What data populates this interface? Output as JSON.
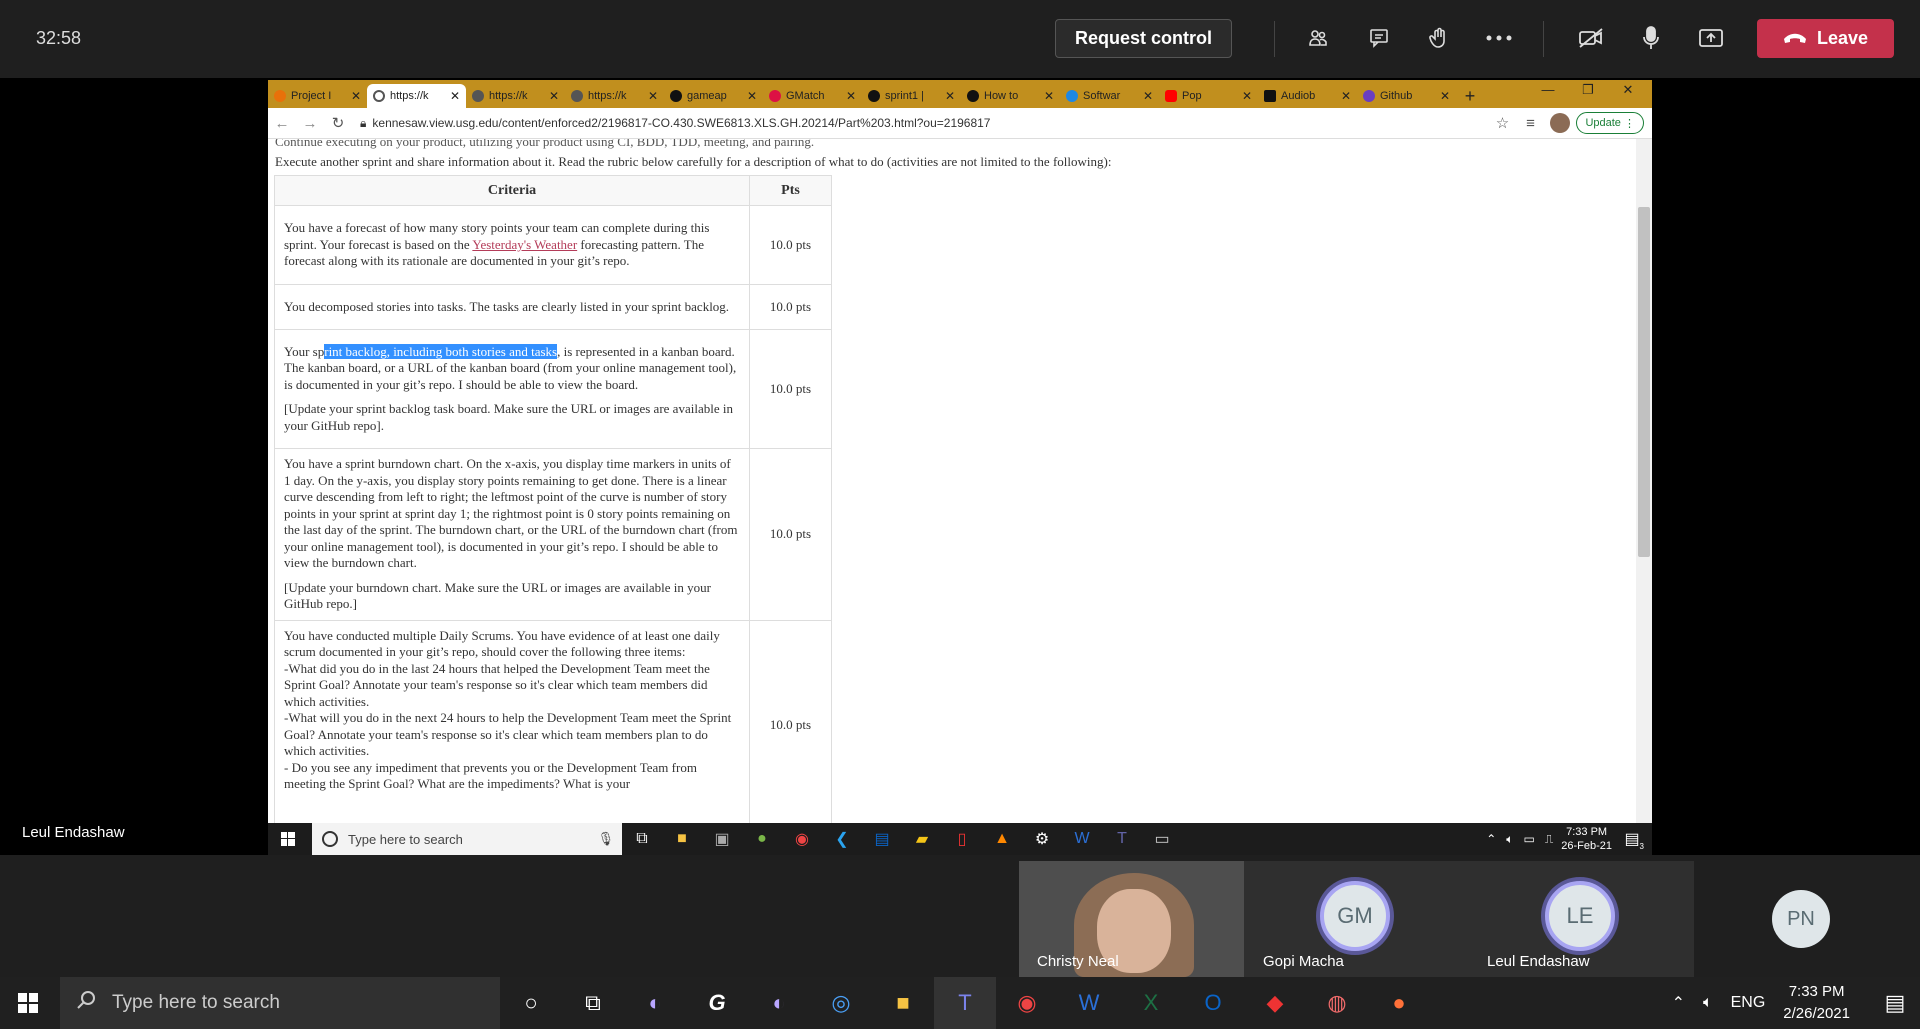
{
  "teams": {
    "timer": "32:58",
    "request_control": "Request control",
    "leave": "Leave",
    "presenter": "Leul Endashaw",
    "icons": [
      "people-icon",
      "chat-icon",
      "raise-hand-icon",
      "more-icon",
      "camera-off-icon",
      "mic-icon",
      "share-icon"
    ]
  },
  "browser": {
    "tabs": [
      {
        "label": "Project I"
      },
      {
        "label": "https://k"
      },
      {
        "label": "https://k"
      },
      {
        "label": "https://k"
      },
      {
        "label": "gameap"
      },
      {
        "label": "GMatch"
      },
      {
        "label": "sprint1 |"
      },
      {
        "label": "How to"
      },
      {
        "label": "Softwar"
      },
      {
        "label": "Pop"
      },
      {
        "label": "Audiob"
      },
      {
        "label": "Github"
      }
    ],
    "url": "kennesaw.view.usg.edu/content/enforced2/2196817-CO.430.SWE6813.XLS.GH.20214/Part%203.html?ou=2196817",
    "update": "Update"
  },
  "page": {
    "cutoff": "Continue executing on your product, utilizing your product using CI, BDD, TDD, meeting, and pairing.",
    "intro": "Execute another sprint and share information about it. Read the rubric below carefully for a description of what to do (activities are not limited to the following):",
    "th_criteria": "Criteria",
    "th_pts": "Pts",
    "r1_a": "You have a forecast of how many story points your team can complete during this sprint. Your forecast is based on the ",
    "r1_link": "Yesterday's Weather",
    "r1_b": " forecasting pattern. The forecast along with its rationale are documented in your git’s repo.",
    "r1_pts": "10.0 pts",
    "r2": "You decomposed stories into tasks. The tasks are clearly listed in your sprint backlog.",
    "r2_pts": "10.0 pts",
    "r3_a": "Your sp",
    "r3_hl": "rint backlog, including both stories and tasks",
    "r3_b": ", is represented in a kanban board. The kanban board, or a URL of the kanban board (from your online management tool), is documented in your git’s repo. I should be able to view the board.",
    "r3_c": "[Update your sprint backlog task board. Make sure the URL or images are available in your GitHub repo].",
    "r3_pts": "10.0 pts",
    "r4_a": "You have a sprint burndown chart. On the x-axis, you display time markers in units of 1 day. On the y-axis, you display story points remaining to get done. There is a linear curve descending from left to right; the leftmost point of the curve is number of story points in your sprint at sprint day 1; the rightmost point is 0 story points remaining on the last day of the sprint. The burndown chart, or the URL of the burndown chart (from your online management tool), is documented in your git’s repo. I should be able to view the burndown chart.",
    "r4_b": "[Update your burndown chart. Make sure the URL or images are available in your GitHub repo.]",
    "r4_pts": "10.0 pts",
    "r5": "You have conducted multiple Daily Scrums. You have evidence of at least one daily scrum documented in your git’s repo, should cover the following three items:",
    "r5_1": "-What did you do in the last 24 hours that helped the Development Team meet the Sprint Goal? Annotate your team's response so it's clear which team members did which activities.",
    "r5_2": "-What will you do in the next 24 hours to help the Development Team meet the Sprint Goal? Annotate your team's response so it's clear which team members plan to do which activities.",
    "r5_3": "- Do you see any impediment that prevents you or the Development Team from meeting the Sprint Goal? What are the impediments? What is your",
    "r5_pts": "10.0 pts"
  },
  "inner_taskbar": {
    "search": "Type here to search",
    "time": "7:33 PM",
    "date": "26-Feb-21",
    "badge": "3"
  },
  "participants": {
    "christy": "Christy Neal",
    "gopi": "Gopi Macha",
    "gopi_initials": "GM",
    "leul": "Leul Endashaw",
    "leul_initials": "LE",
    "pn_initials": "PN"
  },
  "taskbar": {
    "search": "Type here to search",
    "lang": "ENG",
    "time": "7:33 PM",
    "date": "2/26/2021"
  }
}
